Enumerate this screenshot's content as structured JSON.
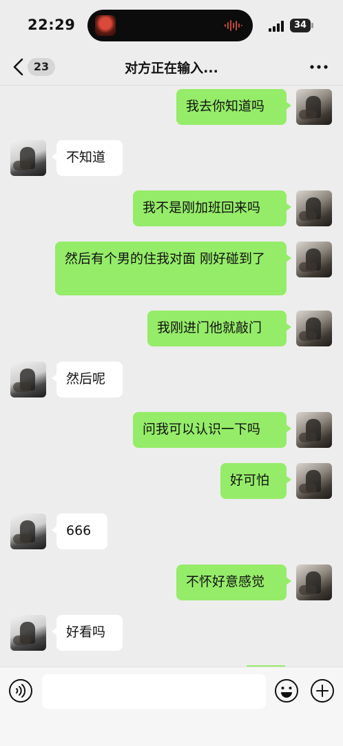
{
  "status_bar": {
    "time": "22:29",
    "battery": "34"
  },
  "nav": {
    "unread_count": "23",
    "title": "对方正在输入..."
  },
  "messages": [
    {
      "side": "me",
      "text": "我去你知道吗"
    },
    {
      "side": "them",
      "text": "不知道"
    },
    {
      "side": "me",
      "text": "我不是刚加班回来吗"
    },
    {
      "side": "me",
      "text": "然后有个男的住我对面 刚好碰到了"
    },
    {
      "side": "me",
      "text": "我刚进门他就敲门"
    },
    {
      "side": "them",
      "text": "然后呢"
    },
    {
      "side": "me",
      "text": "问我可以认识一下吗"
    },
    {
      "side": "me",
      "text": "好可怕"
    },
    {
      "side": "them",
      "text": "666"
    },
    {
      "side": "me",
      "text": "不怀好意感觉"
    },
    {
      "side": "them",
      "text": "好看吗"
    }
  ],
  "input": {
    "value": ""
  },
  "icons": {
    "voice": "voice-icon",
    "emoji": "emoji-icon",
    "plus": "plus-icon",
    "back": "chevron-left-icon",
    "more": "more-icon"
  },
  "colors": {
    "bubble_me": "#95ec69",
    "bubble_them": "#ffffff",
    "background": "#ededed"
  }
}
